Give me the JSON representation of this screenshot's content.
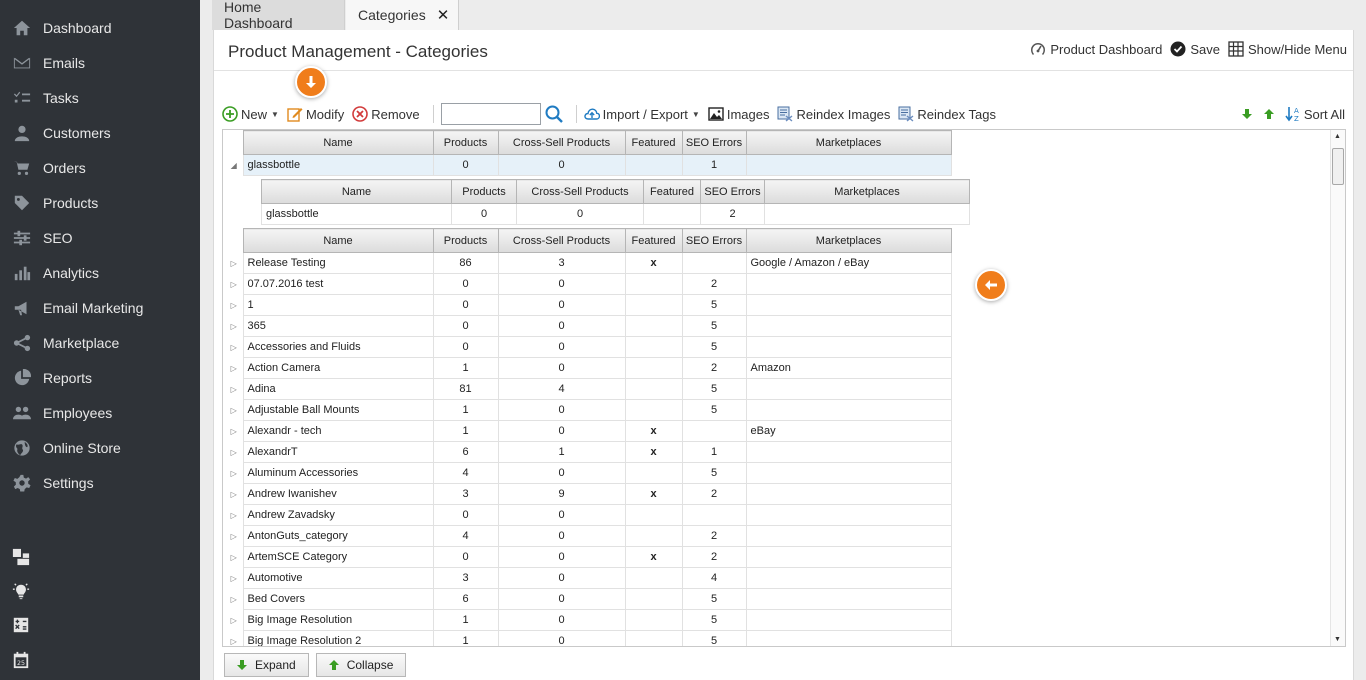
{
  "sidebar": {
    "items": [
      {
        "label": "Dashboard",
        "icon": "home-icon"
      },
      {
        "label": "Emails",
        "icon": "envelope-icon"
      },
      {
        "label": "Tasks",
        "icon": "tasks-icon"
      },
      {
        "label": "Customers",
        "icon": "user-icon"
      },
      {
        "label": "Orders",
        "icon": "cart-icon"
      },
      {
        "label": "Products",
        "icon": "tag-icon"
      },
      {
        "label": "SEO",
        "icon": "sliders-icon"
      },
      {
        "label": "Analytics",
        "icon": "bar-chart-icon"
      },
      {
        "label": "Email Marketing",
        "icon": "megaphone-icon"
      },
      {
        "label": "Marketplace",
        "icon": "share-icon"
      },
      {
        "label": "Reports",
        "icon": "pie-chart-icon"
      },
      {
        "label": "Employees",
        "icon": "users-icon"
      },
      {
        "label": "Online Store",
        "icon": "globe-icon"
      },
      {
        "label": "Settings",
        "icon": "gear-icon"
      }
    ],
    "tools": [
      "layout-icon",
      "lightbulb-icon",
      "calculator-icon",
      "calendar-icon"
    ]
  },
  "tabs": [
    {
      "label": "Home Dashboard",
      "active": false
    },
    {
      "label": "Categories",
      "active": true,
      "close": "✕"
    }
  ],
  "header": {
    "title": "Product Management - Categories",
    "actions": [
      "Product Dashboard",
      "Save",
      "Show/Hide Menu"
    ]
  },
  "toolbar": {
    "new": "New",
    "modify": "Modify",
    "remove": "Remove",
    "search_value": "",
    "import_export": "Import / Export",
    "images": "Images",
    "reindex_images": "Reindex Images",
    "reindex_tags": "Reindex Tags",
    "sort_all": "Sort All"
  },
  "columns": [
    "Name",
    "Products",
    "Cross-Sell Products",
    "Featured",
    "SEO Errors",
    "Marketplaces"
  ],
  "selected_row": {
    "name": "glassbottle",
    "products": "0",
    "cross": "0",
    "featured": "",
    "seo": "1",
    "markets": ""
  },
  "child_row": {
    "name": "glassbottle",
    "products": "0",
    "cross": "0",
    "featured": "",
    "seo": "2",
    "markets": ""
  },
  "rows": [
    {
      "name": "Release Testing",
      "products": "86",
      "cross": "3",
      "featured": "x",
      "seo": "",
      "markets": "Google / Amazon / eBay"
    },
    {
      "name": "07.07.2016 test",
      "products": "0",
      "cross": "0",
      "featured": "",
      "seo": "2",
      "markets": ""
    },
    {
      "name": "1",
      "products": "0",
      "cross": "0",
      "featured": "",
      "seo": "5",
      "markets": ""
    },
    {
      "name": "365",
      "products": "0",
      "cross": "0",
      "featured": "",
      "seo": "5",
      "markets": ""
    },
    {
      "name": "Accessories and Fluids",
      "products": "0",
      "cross": "0",
      "featured": "",
      "seo": "5",
      "markets": ""
    },
    {
      "name": "Action Camera",
      "products": "1",
      "cross": "0",
      "featured": "",
      "seo": "2",
      "markets": "Amazon"
    },
    {
      "name": "Adina",
      "products": "81",
      "cross": "4",
      "featured": "",
      "seo": "5",
      "markets": ""
    },
    {
      "name": "Adjustable Ball Mounts",
      "products": "1",
      "cross": "0",
      "featured": "",
      "seo": "5",
      "markets": ""
    },
    {
      "name": "Alexandr - tech",
      "products": "1",
      "cross": "0",
      "featured": "x",
      "seo": "",
      "markets": "eBay"
    },
    {
      "name": "AlexandrT",
      "products": "6",
      "cross": "1",
      "featured": "x",
      "seo": "1",
      "markets": ""
    },
    {
      "name": "Aluminum Accessories",
      "products": "4",
      "cross": "0",
      "featured": "",
      "seo": "5",
      "markets": ""
    },
    {
      "name": "Andrew Iwanishev",
      "products": "3",
      "cross": "9",
      "featured": "x",
      "seo": "2",
      "markets": ""
    },
    {
      "name": "Andrew Zavadsky",
      "products": "0",
      "cross": "0",
      "featured": "",
      "seo": "",
      "markets": ""
    },
    {
      "name": "AntonGuts_category",
      "products": "4",
      "cross": "0",
      "featured": "",
      "seo": "2",
      "markets": ""
    },
    {
      "name": "ArtemSCE Category",
      "products": "0",
      "cross": "0",
      "featured": "x",
      "seo": "2",
      "markets": ""
    },
    {
      "name": "Automotive",
      "products": "3",
      "cross": "0",
      "featured": "",
      "seo": "4",
      "markets": ""
    },
    {
      "name": "Bed Covers",
      "products": "6",
      "cross": "0",
      "featured": "",
      "seo": "5",
      "markets": ""
    },
    {
      "name": "Big Image Resolution",
      "products": "1",
      "cross": "0",
      "featured": "",
      "seo": "5",
      "markets": ""
    },
    {
      "name": "Big Image Resolution 2",
      "products": "1",
      "cross": "0",
      "featured": "",
      "seo": "5",
      "markets": ""
    }
  ],
  "footer": {
    "expand": "Expand",
    "collapse": "Collapse"
  },
  "colors": {
    "sidebar": "#2f3338",
    "accent": "#f07d1b",
    "green": "#3a9d23",
    "selected_row": "#e6f1f9"
  }
}
